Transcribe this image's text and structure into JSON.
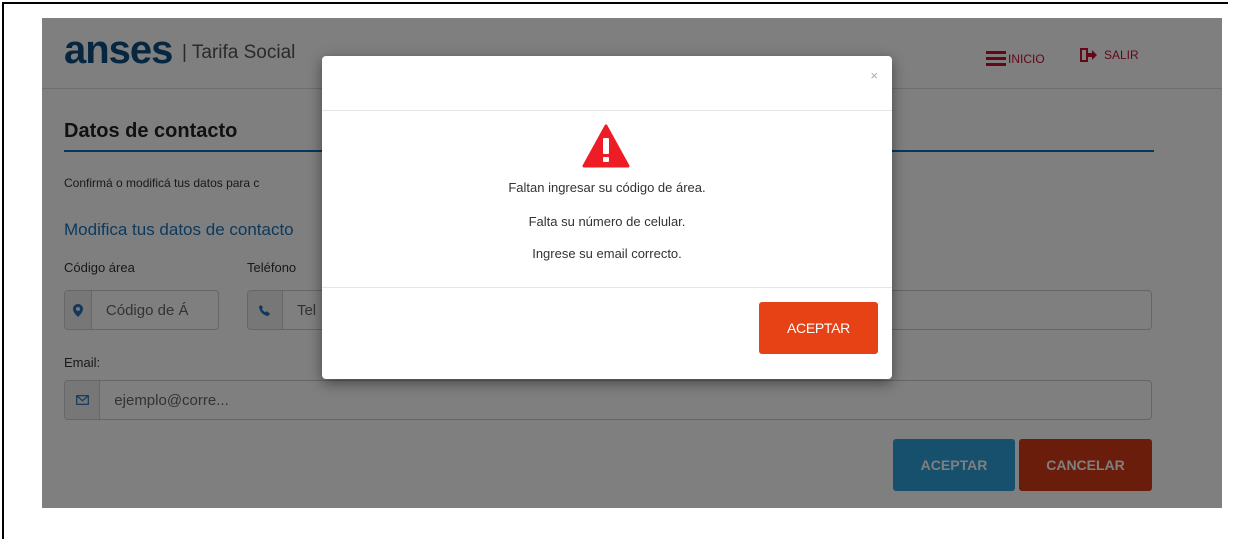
{
  "header": {
    "logo": "anses",
    "subtitle": "| Tarifa Social",
    "nav_inicio": "INICIO",
    "nav_salir": "SALIR"
  },
  "form": {
    "title": "Datos de contacto",
    "description": "Confirmá o modificá tus datos para c",
    "subtitle": "Modifica tus datos de contacto",
    "area_label": "Código área",
    "phone_label": "Teléfono",
    "area_placeholder": "Código de Á",
    "phone_placeholder": "Tel",
    "email_label": "Email:",
    "email_placeholder": "ejemplo@corre...",
    "accept_label": "ACEPTAR",
    "cancel_label": "CANCELAR"
  },
  "modal": {
    "close": "×",
    "messages": [
      "Faltan ingresar su código de área.",
      "Falta su número de celular.",
      "Ingrese su email correcto."
    ],
    "accept_label": "ACEPTAR"
  },
  "colors": {
    "brand": "#0e4f82",
    "accent_blue": "#2ea0d8",
    "danger": "#e64216",
    "nav_red": "#c5112e"
  }
}
